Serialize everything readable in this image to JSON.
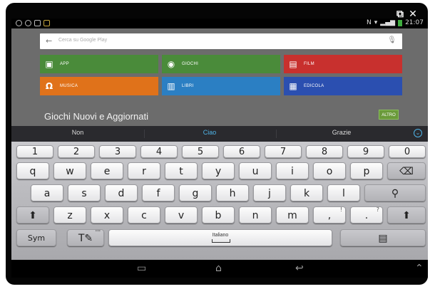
{
  "status_bar": {
    "time": "21:07"
  },
  "play_store": {
    "search_placeholder": "Cerca su Google Play",
    "tiles": [
      {
        "label": "APP",
        "color": "#4a8b3a",
        "icon": "android-icon"
      },
      {
        "label": "GIOCHI",
        "color": "#4a8b3a",
        "icon": "gamepad-icon"
      },
      {
        "label": "FILM",
        "color": "#c8302e",
        "icon": "film-icon"
      },
      {
        "label": "MUSICA",
        "color": "#e0721a",
        "icon": "headphones-icon"
      },
      {
        "label": "LIBRI",
        "color": "#2b7fc3",
        "icon": "book-icon"
      },
      {
        "label": "EDICOLA",
        "color": "#2b4fb0",
        "icon": "newsstand-icon"
      }
    ],
    "section_title": "Giochi Nuovi e Aggiornati",
    "more_button": "ALTRO"
  },
  "suggestions": {
    "left": "Non",
    "middle": "Ciao",
    "right": "Grazie"
  },
  "keyboard": {
    "number_row": [
      "1",
      "2",
      "3",
      "4",
      "5",
      "6",
      "7",
      "8",
      "9",
      "0"
    ],
    "row1": [
      "q",
      "w",
      "e",
      "r",
      "t",
      "y",
      "u",
      "i",
      "o",
      "p"
    ],
    "row2": [
      "a",
      "s",
      "d",
      "f",
      "g",
      "h",
      "j",
      "k",
      "l"
    ],
    "row3": [
      "z",
      "x",
      "c",
      "v",
      "b",
      "n",
      "m"
    ],
    "comma": ",",
    "comma_sub": "!",
    "period": ".",
    "period_sub": "?",
    "sym": "Sym",
    "space_label": "Italiano",
    "text_tool_sub": "\"\""
  }
}
